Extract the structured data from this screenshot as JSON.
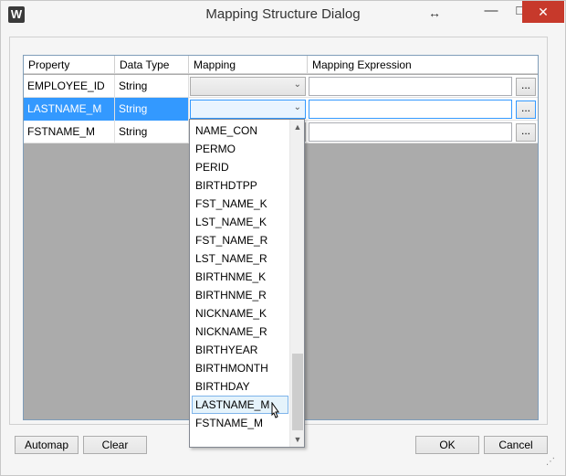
{
  "window": {
    "title": "Mapping Structure Dialog",
    "app_icon_letter": "W",
    "resize_glyph": "↔",
    "minimize_glyph": "—",
    "maximize_glyph": "□",
    "close_glyph": "✕"
  },
  "grid": {
    "columns": [
      "Property",
      "Data Type",
      "Mapping",
      "Mapping Expression"
    ],
    "rows": [
      {
        "property": "EMPLOYEE_ID",
        "data_type": "String",
        "mapping": "",
        "expression": ""
      },
      {
        "property": "LASTNAME_M",
        "data_type": "String",
        "mapping": "",
        "expression": "",
        "selected": true
      },
      {
        "property": "FSTNAME_M",
        "data_type": "String",
        "mapping": "",
        "expression": ""
      }
    ],
    "ellipsis_label": "...",
    "combo_arrow": "⌄"
  },
  "dropdown": {
    "options": [
      "NAME_CON",
      "PERMO",
      "PERID",
      "BIRTHDTPP",
      "FST_NAME_K",
      "LST_NAME_K",
      "FST_NAME_R",
      "LST_NAME_R",
      "BIRTHNME_K",
      "BIRTHNME_R",
      "NICKNAME_K",
      "NICKNAME_R",
      "BIRTHYEAR",
      "BIRTHMONTH",
      "BIRTHDAY",
      "LASTNAME_M",
      "FSTNAME_M"
    ],
    "hovered_option": "LASTNAME_M",
    "scroll_fraction": 1.0
  },
  "buttons": {
    "automap": "Automap",
    "clear": "Clear",
    "ok": "OK",
    "cancel": "Cancel"
  },
  "colors": {
    "selection": "#3399ff",
    "close_button": "#c7392b"
  }
}
